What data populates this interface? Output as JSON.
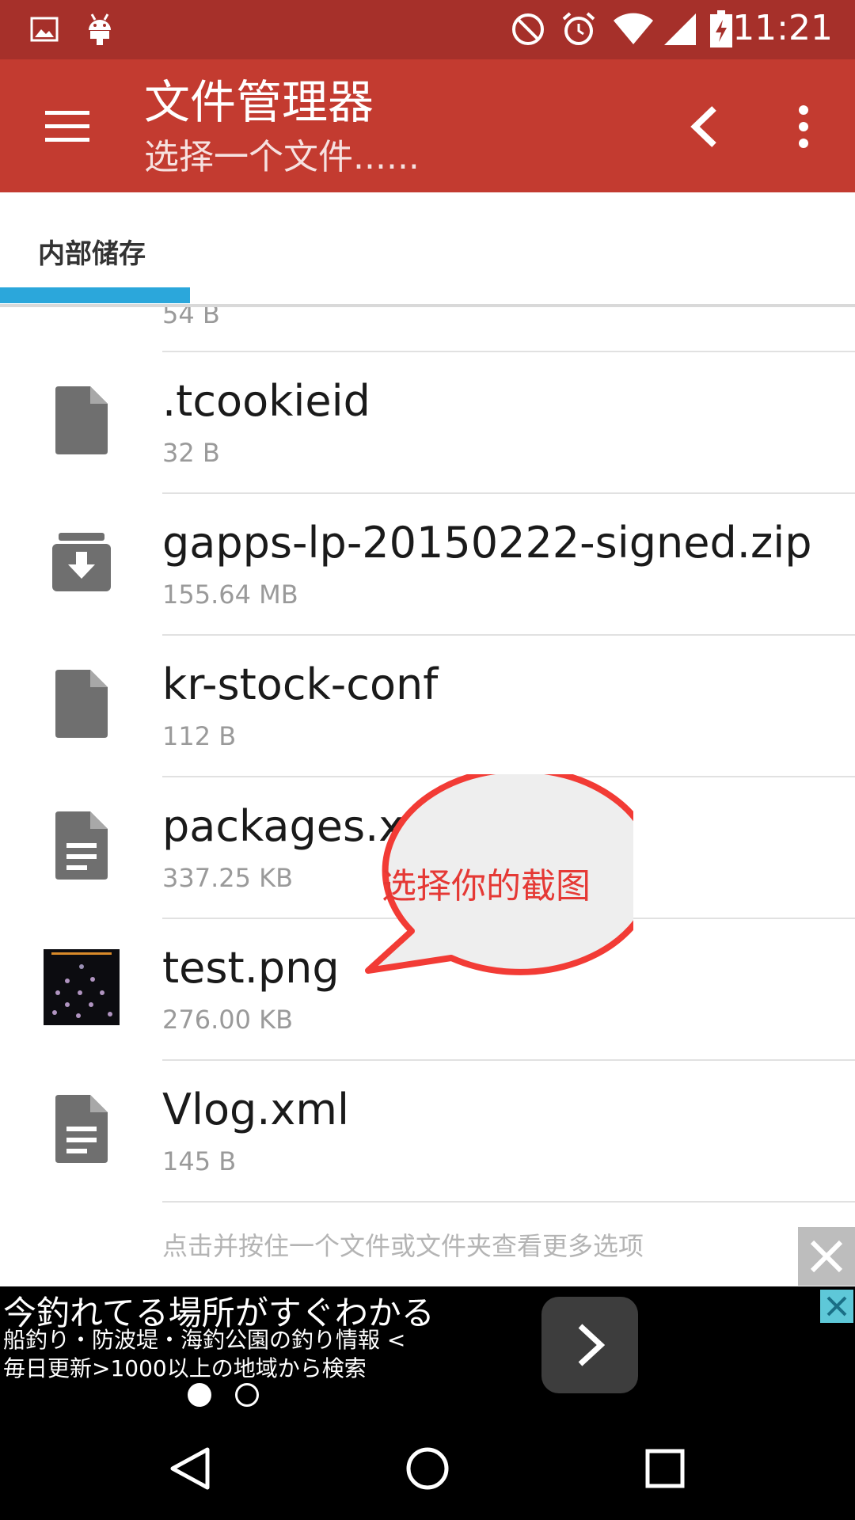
{
  "status_bar": {
    "time": "11:21",
    "icons": [
      "image-icon",
      "android-icon",
      "do-not-disturb-icon",
      "alarm-icon",
      "wifi-icon",
      "signal-icon",
      "battery-charging-icon"
    ]
  },
  "app_bar": {
    "title": "文件管理器",
    "subtitle": "选择一个文件......",
    "color": "#c33b30",
    "status_color": "#a6302a"
  },
  "tabs": [
    {
      "label": "内部储存",
      "active": true
    }
  ],
  "accent_color": "#2ba7db",
  "partial_item": {
    "size": "54 B"
  },
  "files": [
    {
      "name": ".tcookieid",
      "size": "32 B",
      "icon": "file-icon"
    },
    {
      "name": "gapps-lp-20150222-signed.zip",
      "size": "155.64 MB",
      "icon": "archive-icon"
    },
    {
      "name": "kr-stock-conf",
      "size": "112 B",
      "icon": "file-icon"
    },
    {
      "name": "packages.x",
      "size": "337.25 KB",
      "icon": "document-icon"
    },
    {
      "name": "test.png",
      "size": "276.00 KB",
      "icon": "image-thumbnail"
    },
    {
      "name": "Vlog.xml",
      "size": "145 B",
      "icon": "document-icon"
    }
  ],
  "hint": "点击并按住一个文件或文件夹查看更多选项",
  "callout": {
    "text": "选择你的截图",
    "color": "#e53935"
  },
  "ad": {
    "headline": "今釣れてる場所がすぐわかる",
    "line1": "船釣り・防波堤・海釣公園の釣り情報 <",
    "line2": "毎日更新>1000以上の地域から検索"
  },
  "navigation": [
    "back-icon",
    "home-icon",
    "recents-icon"
  ]
}
